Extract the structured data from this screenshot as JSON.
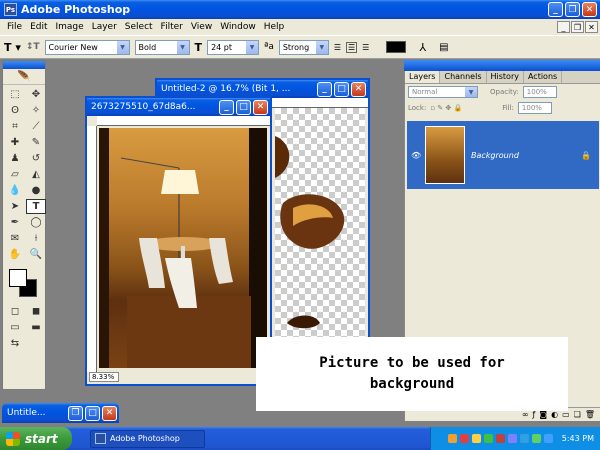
{
  "app": {
    "title": "Adobe Photoshop"
  },
  "menu": [
    "File",
    "Edit",
    "Image",
    "Layer",
    "Select",
    "Filter",
    "View",
    "Window",
    "Help"
  ],
  "options": {
    "font_family": "Courier New",
    "font_style": "Bold",
    "font_size": "24 pt",
    "aa_label": "a",
    "aa_mode": "Strong"
  },
  "windows": {
    "untitled2_title": "Untitled-2 @ 16.7% (Bit 1, ...",
    "photo_title": "2673275510_67d8a6...",
    "photo_zoom": "8.33%",
    "minimized_title": "Untitle..."
  },
  "layers_panel": {
    "tabs": [
      "Layers",
      "Channels",
      "History",
      "Actions"
    ],
    "blend_mode": "Normal",
    "opacity_label": "Opacity:",
    "opacity_value": "100%",
    "lock_label": "Lock:",
    "fill_label": "Fill:",
    "fill_value": "100%",
    "layer_name": "Background"
  },
  "caption": {
    "text": "Picture to be used for\nbackground"
  },
  "taskbar": {
    "start_label": "start",
    "task_label": "Adobe Photoshop",
    "clock": "5:43 PM"
  },
  "colors": {
    "xp_blue": "#0a4fd0",
    "selected_layer": "#316ac5",
    "start_green": "#3b9a3b"
  }
}
